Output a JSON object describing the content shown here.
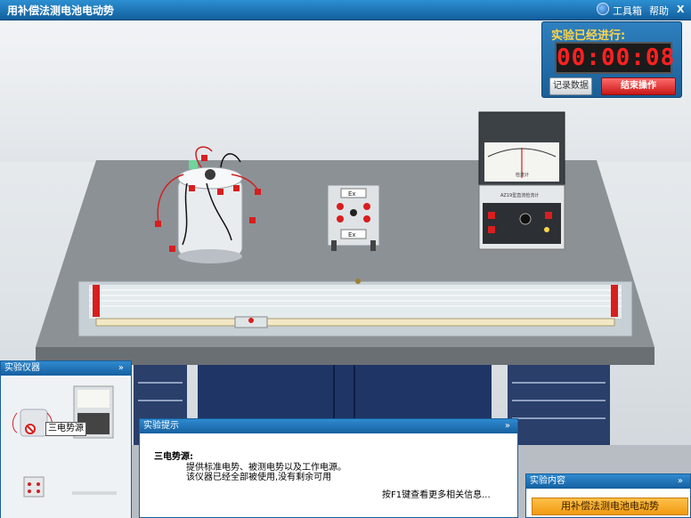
{
  "titlebar": {
    "title": "用补偿法测电池电动势",
    "toolbox_label": "工具箱",
    "help_label": "帮助",
    "close_label": "X"
  },
  "timer": {
    "label": "实验已经进行:",
    "time": "00:00:08",
    "record_label": "记录数据",
    "end_label": "结束操作"
  },
  "apparatus": {
    "ex_top_label": "Ex",
    "ex_bottom_label": "Ex",
    "meter_scale_label": "检流计",
    "meter_name_label": "AZ19型直流检流计"
  },
  "instruments_panel": {
    "title": "实验仪器",
    "tooltip": "三电势源"
  },
  "hint_panel": {
    "title": "实验提示",
    "item_title": "三电势源:",
    "line1": "提供标准电势、被测电势以及工作电源。",
    "line2": "该仪器已经全部被使用,没有剩余可用",
    "more": "按F1键查看更多相关信息..."
  },
  "content_panel": {
    "title": "实验内容",
    "experiment": "用补偿法测电池电动势"
  },
  "colors": {
    "title_blue": "#1a6fb2",
    "timer_red": "#ff2020",
    "accent_orange": "#f5a623",
    "terminal_red": "#d81e1e"
  }
}
